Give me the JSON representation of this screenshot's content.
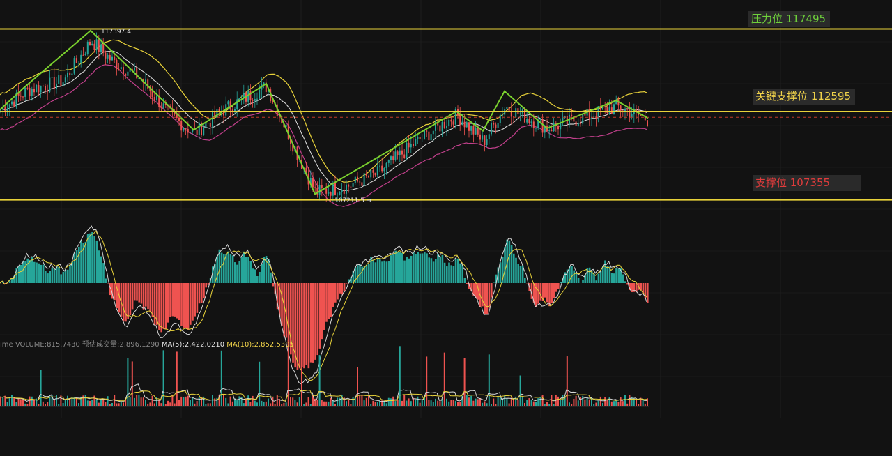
{
  "levels": {
    "resistance": {
      "label": "压力位 117495",
      "value": 117495,
      "color": "#6fd13b"
    },
    "key_support": {
      "label": "关键支撑位 112595",
      "value": 112595,
      "color": "#f0d24a"
    },
    "support": {
      "label": "支撑位 107355",
      "value": 107355,
      "color": "#e03c3c"
    }
  },
  "extremes": {
    "high_label": "117397.4",
    "low_label": "107211.5 →"
  },
  "volume_legend": {
    "prefix": "ıme  VOLUME:815.7430",
    "estimated": "预估成交量:2,896.1290",
    "ma5": "MA(5):2,422.0210",
    "ma10": "MA(10):2,852.5305"
  },
  "colors": {
    "background": "#121212",
    "up": "#26a69a",
    "down": "#ef5350",
    "level_line": "#e8d23a",
    "zigzag": "#7bd12e",
    "ma_white": "#d8d8d8",
    "ma_yellow": "#e8d23a",
    "lower_band": "#c2408c",
    "current_price_line": "#c0392b"
  },
  "chart_data": {
    "type": "line",
    "title": "",
    "ylim": [
      106800,
      118800
    ],
    "zigzag": {
      "x": [
        0,
        34,
        130,
        278,
        382,
        452,
        655,
        693,
        724,
        785,
        884,
        930
      ],
      "y": [
        112700,
        114000,
        117397,
        111500,
        114250,
        107700,
        112600,
        111450,
        113800,
        111600,
        113250,
        112200
      ]
    },
    "price_path": {
      "x": [
        0,
        40,
        90,
        130,
        160,
        200,
        240,
        278,
        320,
        382,
        420,
        452,
        500,
        540,
        600,
        655,
        693,
        724,
        785,
        840,
        884,
        930
      ],
      "y": [
        112700,
        113900,
        114400,
        116800,
        115600,
        114600,
        112500,
        111300,
        112700,
        114100,
        110600,
        107800,
        108200,
        108900,
        110900,
        112400,
        110800,
        112900,
        111600,
        112300,
        112900,
        112100
      ]
    },
    "macd_histogram_peak_up": 1,
    "current_price": 112250,
    "panels": [
      "price",
      "macd",
      "volume"
    ]
  }
}
